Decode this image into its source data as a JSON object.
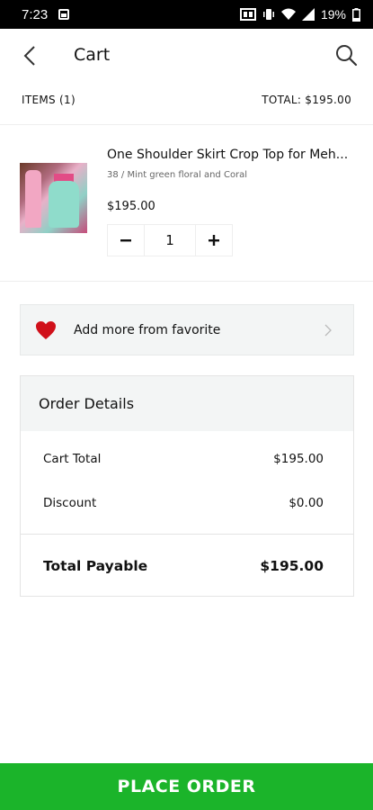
{
  "status_bar": {
    "time": "7:23",
    "battery": "19%"
  },
  "header": {
    "title": "Cart"
  },
  "summary": {
    "items_label": "ITEMS (1)",
    "total_label": "TOTAL: $195.00"
  },
  "product": {
    "name": "One Shoulder Skirt Crop Top for Meh...",
    "variant": "38 / Mint green floral and Coral",
    "price": "$195.00",
    "quantity": "1"
  },
  "favorites": {
    "label": "Add more from favorite"
  },
  "order": {
    "title": "Order Details",
    "cart_total_label": "Cart Total",
    "cart_total_value": "$195.00",
    "discount_label": "Discount",
    "discount_value": "$0.00",
    "payable_label": "Total Payable",
    "payable_value": "$195.00"
  },
  "footer": {
    "place_order_label": "PLACE ORDER"
  },
  "icons": {
    "back": "chevron-left-icon",
    "search": "search-icon",
    "heart": "heart-icon",
    "chevron": "chevron-right-icon"
  },
  "colors": {
    "accent": "#1bb42a",
    "heart": "#d0101a"
  }
}
